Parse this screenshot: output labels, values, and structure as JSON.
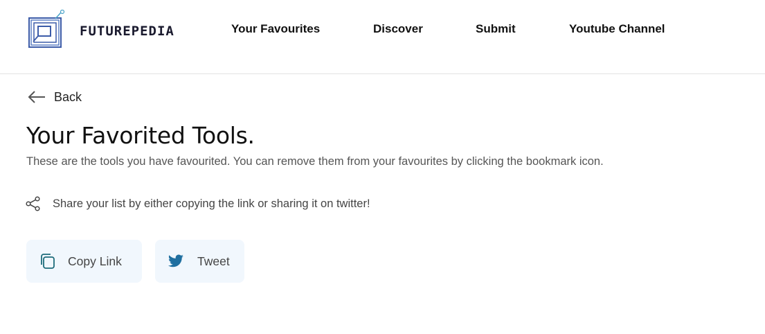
{
  "header": {
    "logo_text": "FUTUREPEDIA",
    "nav": {
      "favourites": "Your Favourites",
      "discover": "Discover",
      "submit": "Submit",
      "youtube": "Youtube Channel"
    }
  },
  "main": {
    "back_label": "Back",
    "title": "Your Favorited Tools.",
    "description": "These are the tools you have favourited. You can remove them from your favourites by clicking the bookmark icon.",
    "share_text": "Share your list by either copying the link or sharing it on twitter!",
    "copy_label": "Copy Link",
    "tweet_label": "Tweet"
  },
  "icons": {
    "logo": "futurepedia-logo-icon",
    "back": "arrow-left-icon",
    "share": "share-icon",
    "copy": "copy-icon",
    "tweet": "twitter-icon"
  },
  "colors": {
    "logo_blue": "#3b5ba8",
    "logo_accent": "#4aa3c8",
    "button_bg": "#f1f7fd",
    "icon_teal": "#1d6b7a",
    "twitter_blue": "#1f6fa0"
  }
}
